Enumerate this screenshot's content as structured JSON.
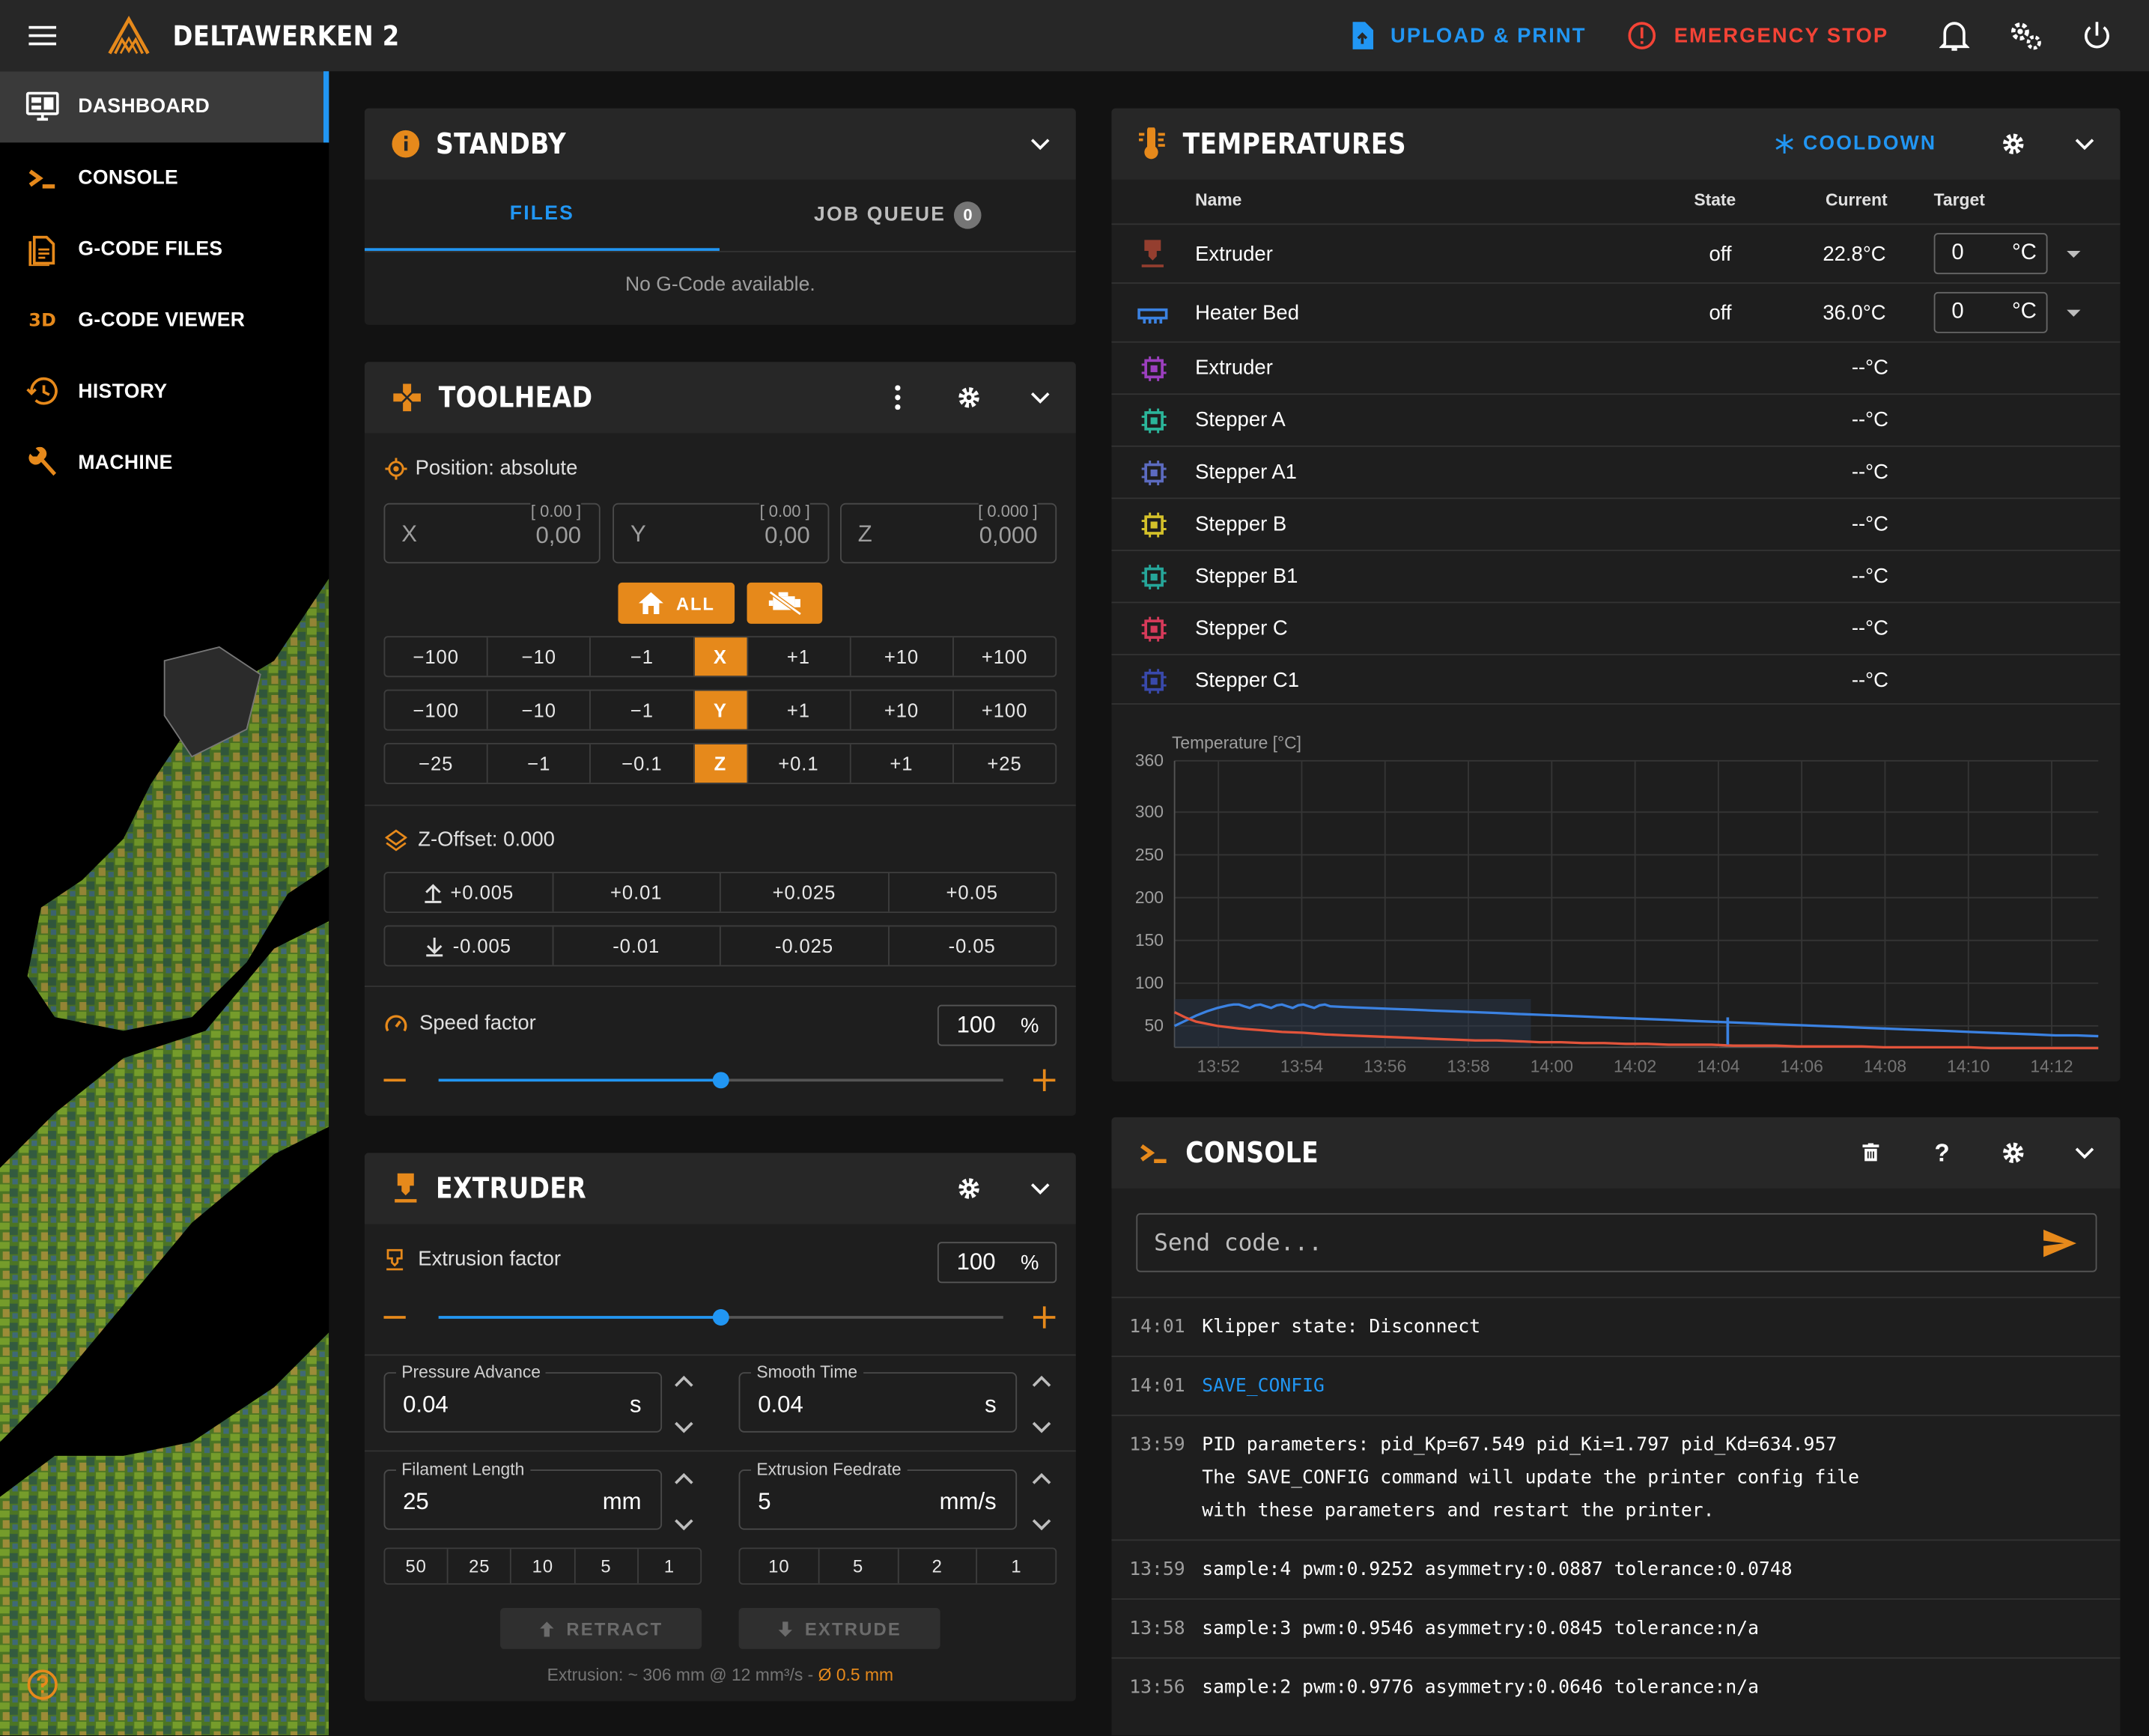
{
  "topbar": {
    "brand": "DELTAWERKEN 2",
    "upload_label": "UPLOAD & PRINT",
    "estop_label": "EMERGENCY STOP"
  },
  "sidebar": {
    "items": [
      {
        "label": "DASHBOARD",
        "icon": "monitor-dashboard-icon",
        "active": true
      },
      {
        "label": "CONSOLE",
        "icon": "console-prompt-icon"
      },
      {
        "label": "G-CODE FILES",
        "icon": "file-document-icon"
      },
      {
        "label": "G-CODE VIEWER",
        "icon": "3d-icon"
      },
      {
        "label": "HISTORY",
        "icon": "history-icon"
      },
      {
        "label": "MACHINE",
        "icon": "wrench-icon"
      }
    ]
  },
  "standby": {
    "title": "STANDBY",
    "tab_files": "FILES",
    "tab_queue": "JOB QUEUE",
    "queue_count": "0",
    "empty": "No G-Code available."
  },
  "toolhead": {
    "title": "TOOLHEAD",
    "position_label": "Position: absolute",
    "x": {
      "label": "X",
      "value": "0,00",
      "hint": "[ 0.00 ]"
    },
    "y": {
      "label": "Y",
      "value": "0,00",
      "hint": "[ 0.00 ]"
    },
    "z": {
      "label": "Z",
      "value": "0,000",
      "hint": "[ 0.000 ]"
    },
    "home_all": "ALL",
    "rows": [
      {
        "axis": "X",
        "neg": [
          "−100",
          "−10",
          "−1"
        ],
        "pos": [
          "+1",
          "+10",
          "+100"
        ]
      },
      {
        "axis": "Y",
        "neg": [
          "−100",
          "−10",
          "−1"
        ],
        "pos": [
          "+1",
          "+10",
          "+100"
        ]
      },
      {
        "axis": "Z",
        "neg": [
          "−25",
          "−1",
          "−0.1"
        ],
        "pos": [
          "+0.1",
          "+1",
          "+25"
        ]
      }
    ],
    "zoffset_label": "Z-Offset: 0.000",
    "zoff_up": [
      "+0.005",
      "+0.01",
      "+0.025",
      "+0.05"
    ],
    "zoff_down": [
      "-0.005",
      "-0.01",
      "-0.025",
      "-0.05"
    ],
    "speed_label": "Speed factor",
    "speed_value": "100",
    "speed_unit": "%",
    "speed_fraction": 0.5
  },
  "extruder": {
    "title": "EXTRUDER",
    "factor_label": "Extrusion factor",
    "factor_value": "100",
    "factor_unit": "%",
    "factor_fraction": 0.5,
    "pa": {
      "label": "Pressure Advance",
      "value": "0.04",
      "unit": "s"
    },
    "st": {
      "label": "Smooth Time",
      "value": "0.04",
      "unit": "s"
    },
    "fl": {
      "label": "Filament Length",
      "value": "25",
      "unit": "mm"
    },
    "ef": {
      "label": "Extrusion Feedrate",
      "value": "5",
      "unit": "mm/s"
    },
    "len_presets": [
      "50",
      "25",
      "10",
      "5",
      "1"
    ],
    "feed_presets": [
      "10",
      "5",
      "2",
      "1"
    ],
    "retract": "RETRACT",
    "extrude": "EXTRUDE",
    "info": "Extrusion: ~ 306 mm @ 12 mm³/s -",
    "info_nozzle": "Ø 0.5 mm"
  },
  "temps": {
    "title": "TEMPERATURES",
    "cooldown": "COOLDOWN",
    "headers": {
      "name": "Name",
      "state": "State",
      "current": "Current",
      "target": "Target"
    },
    "heaters": [
      {
        "name": "Extruder",
        "state": "off",
        "current": "22.8°C",
        "target": "0",
        "unit": "°C",
        "color": "#e2543b"
      },
      {
        "name": "Heater Bed",
        "state": "off",
        "current": "36.0°C",
        "target": "0",
        "unit": "°C",
        "color": "#3b82e2"
      }
    ],
    "sensors": [
      {
        "name": "Extruder",
        "current": "--°C",
        "color": "#9c3fbf"
      },
      {
        "name": "Stepper A",
        "current": "--°C",
        "color": "#2bb59a"
      },
      {
        "name": "Stepper A1",
        "current": "--°C",
        "color": "#5c6bc0"
      },
      {
        "name": "Stepper B",
        "current": "--°C",
        "color": "#d4c12a"
      },
      {
        "name": "Stepper B1",
        "current": "--°C",
        "color": "#26a69a"
      },
      {
        "name": "Stepper C",
        "current": "--°C",
        "color": "#d63a5a"
      },
      {
        "name": "Stepper C1",
        "current": "--°C",
        "color": "#3949ab"
      }
    ]
  },
  "chart_data": {
    "type": "line",
    "ylabel": "Temperature [°C]",
    "yticks": [
      50,
      100,
      150,
      200,
      250,
      300,
      360
    ],
    "ylim": [
      25,
      360
    ],
    "xticks": [
      "13:52",
      "13:54",
      "13:56",
      "13:58",
      "14:00",
      "14:02",
      "14:04",
      "14:06",
      "14:08",
      "14:10",
      "14:12"
    ],
    "xlim_min": [
      13.8,
      14.4
    ],
    "grid": true,
    "series": [
      {
        "color": "#3b82e2",
        "x": [
          13.8,
          13.9,
          14.0,
          14.1,
          14.2,
          14.3,
          14.35,
          14.4,
          14.45,
          14.5,
          14.55,
          14.6,
          14.65,
          14.7,
          14.75,
          14.8,
          14.85,
          14.9,
          14.95,
          15.0,
          15.05,
          15.1,
          15.15,
          15.2,
          15.25,
          15.4,
          15.6,
          15.8,
          16.0,
          16.2,
          16.4,
          16.6,
          16.8,
          17.0,
          17.2,
          17.4,
          17.6,
          17.8,
          18.0,
          18.2,
          18.4,
          18.6,
          18.8,
          19.0,
          19.2,
          19.4,
          19.6,
          19.8,
          20.0,
          20.2,
          20.4,
          20.6,
          20.8,
          21.0,
          21.2,
          21.4,
          21.6,
          21.8,
          22.0,
          22.2,
          22.4
        ],
        "y": [
          50,
          56,
          62,
          67,
          71,
          74,
          75,
          75,
          73,
          71,
          74,
          75,
          73,
          71,
          74,
          75,
          73,
          71,
          74,
          75,
          73,
          71,
          74,
          75,
          73,
          72,
          71,
          70,
          69,
          68,
          67,
          66,
          65,
          64,
          63,
          62,
          61,
          60,
          59,
          58,
          57,
          56,
          55,
          54,
          53,
          52,
          51,
          50,
          49,
          48,
          47,
          46,
          45,
          44,
          43,
          42,
          41,
          40,
          39,
          39,
          38
        ]
      },
      {
        "color": "#e2543b",
        "x": [
          13.8,
          13.9,
          14.0,
          14.2,
          14.4,
          14.6,
          14.8,
          15.0,
          15.2,
          15.4,
          15.6,
          15.8,
          16.0,
          16.2,
          16.4,
          16.6,
          16.8,
          17.0,
          17.2,
          17.4,
          17.6,
          17.8,
          18.0,
          18.2,
          18.4,
          18.6,
          18.8,
          19.0,
          19.2,
          19.4,
          19.6,
          19.8,
          20.0,
          20.2,
          20.4,
          20.6,
          20.8,
          21.0,
          21.2,
          21.4,
          21.6,
          21.8,
          22.0,
          22.2,
          22.4
        ],
        "y": [
          66,
          60,
          55,
          50,
          47,
          45,
          43,
          42,
          40,
          39,
          38,
          37,
          36,
          35,
          34,
          33,
          33,
          32,
          31,
          31,
          30,
          30,
          29,
          29,
          28,
          28,
          28,
          27,
          27,
          27,
          26,
          26,
          26,
          26,
          25,
          25,
          25,
          25,
          25,
          24,
          24,
          24,
          24,
          24,
          24
        ]
      }
    ]
  },
  "console": {
    "title": "CONSOLE",
    "placeholder": "Send code...",
    "lines": [
      {
        "time": "14:01",
        "msg": "Klipper state: Disconnect"
      },
      {
        "time": "14:01",
        "msg": "SAVE_CONFIG",
        "link": true
      },
      {
        "time": "13:59",
        "msg": "PID parameters: pid_Kp=67.549 pid_Ki=1.797 pid_Kd=634.957\nThe SAVE_CONFIG command will update the printer config file\nwith these parameters and restart the printer."
      },
      {
        "time": "13:59",
        "msg": "sample:4 pwm:0.9252 asymmetry:0.0887 tolerance:0.0748"
      },
      {
        "time": "13:58",
        "msg": "sample:3 pwm:0.9546 asymmetry:0.0845 tolerance:n/a"
      },
      {
        "time": "13:56",
        "msg": "sample:2 pwm:0.9776 asymmetry:0.0646 tolerance:n/a"
      }
    ]
  },
  "colors": {
    "accent": "#e6891b",
    "primary": "#2196f3",
    "danger": "#f44336",
    "panel": "#1e1e1e",
    "header": "#272727"
  }
}
